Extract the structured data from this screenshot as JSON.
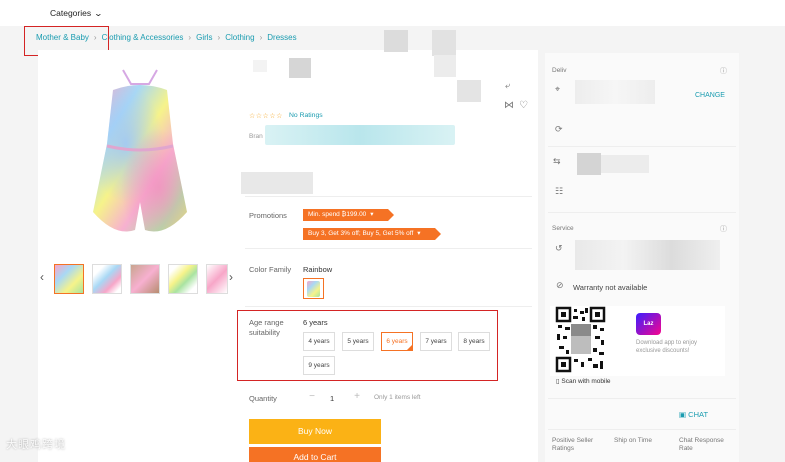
{
  "header": {
    "categories_label": "Categories"
  },
  "breadcrumb": [
    "Mother & Baby",
    "Clothing & Accessories",
    "Girls",
    "Clothing",
    "Dresses"
  ],
  "product": {
    "rating_stars": "☆☆☆☆☆",
    "rating_text": "No Ratings",
    "brand_label": "Bran"
  },
  "promotions": {
    "label": "Promotions",
    "tags": [
      "Min. spend ₿199.00",
      "Buy 3, Get 3% off; Buy 5, Get 5% off"
    ]
  },
  "color": {
    "label": "Color Family",
    "value": "Rainbow"
  },
  "age": {
    "label_line1": "Age range",
    "label_line2": "suitability",
    "selected": "6 years",
    "options": [
      "4 years",
      "5 years",
      "6 years",
      "7 years",
      "8 years",
      "9 years"
    ],
    "active_index": 2
  },
  "quantity": {
    "label": "Quantity",
    "minus": "−",
    "value": "1",
    "plus": "+",
    "stock_note": "Only 1 items left"
  },
  "buttons": {
    "buy_now": "Buy Now",
    "add_to_cart": "Add to Cart"
  },
  "sidebar": {
    "delivery_label": "Deliv",
    "change_label": "CHANGE",
    "service_label": "Service",
    "warranty_text": "Warranty not available",
    "app_badge": "Laz",
    "download_text": "Download app to enjoy exclusive discounts!",
    "scan_text": "Scan with mobile",
    "chat_label": "CHAT",
    "seller_metrics": [
      {
        "line1": "Positive Seller",
        "line2": "Ratings"
      },
      {
        "line1": "Ship on Time",
        "line2": ""
      },
      {
        "line1": "Chat Response",
        "line2": "Rate"
      }
    ]
  },
  "watermark": "大眼鸡跨境",
  "colors": {
    "accent_orange": "#f57224",
    "buy_yellow": "#fbb215",
    "link_teal": "#1a9cb0",
    "highlight_red": "#d42424"
  }
}
